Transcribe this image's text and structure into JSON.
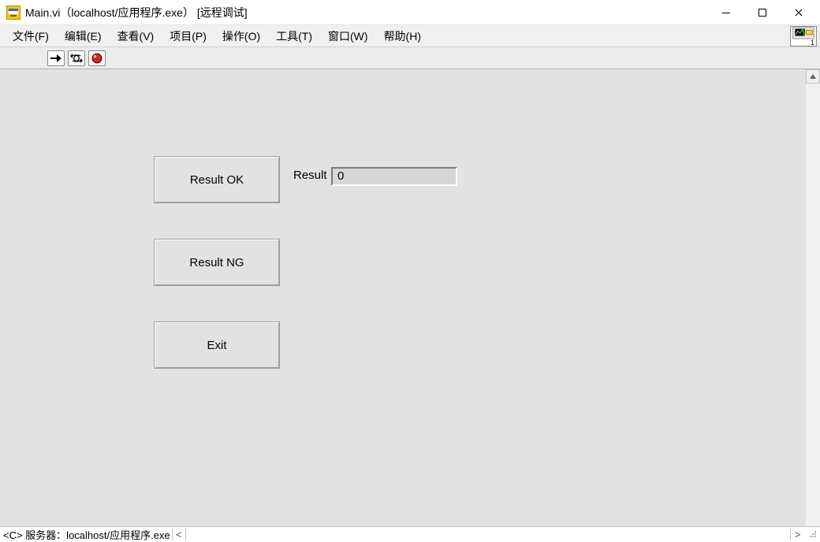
{
  "window": {
    "title": "Main.vi（localhost/应用程序.exe） [远程调试]"
  },
  "menubar": {
    "items": [
      "文件(F)",
      "编辑(E)",
      "查看(V)",
      "项目(P)",
      "操作(O)",
      "工具(T)",
      "窗口(W)",
      "帮助(H)"
    ]
  },
  "vi_icon_badge": "1",
  "panel": {
    "btn_ok": "Result OK",
    "btn_ng": "Result NG",
    "btn_exit": "Exit",
    "result_label": "Result",
    "result_value": "0"
  },
  "statusbar": {
    "text": "<C> 服务器：localhost/应用程序.exe",
    "left_arrow": "<",
    "right_arrow": ">"
  }
}
